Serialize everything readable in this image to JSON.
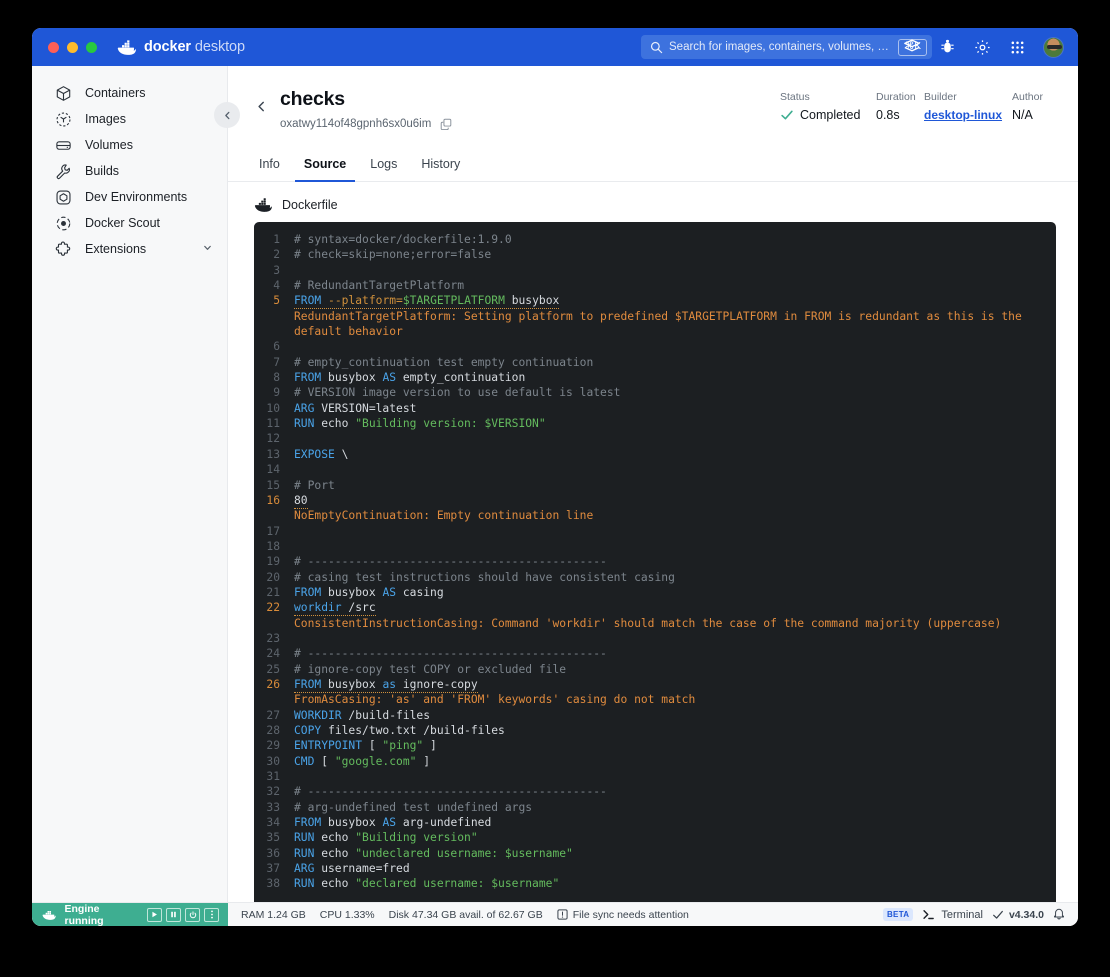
{
  "titlebar": {
    "brand_bold": "docker",
    "brand_light": "desktop",
    "search_placeholder": "Search for images, containers, volumes, extensi...",
    "shortcut": "⌘K",
    "icons": [
      "extensions-icon",
      "bug-icon",
      "gear-icon",
      "grid-icon",
      "avatar"
    ]
  },
  "sidebar": {
    "items": [
      {
        "label": "Containers",
        "icon": "container-icon"
      },
      {
        "label": "Images",
        "icon": "images-icon"
      },
      {
        "label": "Volumes",
        "icon": "volumes-icon"
      },
      {
        "label": "Builds",
        "icon": "wrench-icon"
      },
      {
        "label": "Dev Environments",
        "icon": "dev-environments-icon"
      },
      {
        "label": "Docker Scout",
        "icon": "docker-scout-icon"
      },
      {
        "label": "Extensions",
        "icon": "extensions-puzzle-icon"
      }
    ]
  },
  "header": {
    "title": "checks",
    "build_id": "oxatwy114of48gpnh6sx0u6im",
    "meta": {
      "status_label": "Status",
      "status_value": "Completed",
      "duration_label": "Duration",
      "duration_value": "0.8s",
      "builder_label": "Builder",
      "builder_value": "desktop-linux",
      "author_label": "Author",
      "author_value": "N/A"
    }
  },
  "tabs": [
    {
      "label": "Info",
      "active": false
    },
    {
      "label": "Source",
      "active": true
    },
    {
      "label": "Logs",
      "active": false
    },
    {
      "label": "History",
      "active": false
    }
  ],
  "file": {
    "name": "Dockerfile"
  },
  "code": {
    "lines": [
      {
        "n": "1",
        "tokens": [
          {
            "t": "# syntax=docker/dockerfile:1.9.0",
            "c": "cm"
          }
        ]
      },
      {
        "n": "2",
        "tokens": [
          {
            "t": "# check=skip=none;error=false",
            "c": "cm"
          }
        ]
      },
      {
        "n": "3",
        "tokens": []
      },
      {
        "n": "4",
        "tokens": [
          {
            "t": "# RedundantTargetPlatform",
            "c": "cm"
          }
        ]
      },
      {
        "n": "5",
        "warn": true,
        "underline": true,
        "tokens": [
          {
            "t": "FROM",
            "c": "kw"
          },
          {
            "t": " ",
            "c": ""
          },
          {
            "t": "--platform=",
            "c": "fl"
          },
          {
            "t": "$TARGETPLATFORM",
            "c": "var"
          },
          {
            "t": " busybox",
            "c": ""
          }
        ]
      },
      {
        "msg": "RedundantTargetPlatform: Setting platform to predefined $TARGETPLATFORM in FROM is redundant as this is the default behavior"
      },
      {
        "n": "6",
        "tokens": []
      },
      {
        "n": "7",
        "tokens": [
          {
            "t": "# empty_continuation test empty continuation",
            "c": "cm"
          }
        ]
      },
      {
        "n": "8",
        "tokens": [
          {
            "t": "FROM",
            "c": "kw"
          },
          {
            "t": " busybox ",
            "c": ""
          },
          {
            "t": "AS",
            "c": "kw"
          },
          {
            "t": " empty_continuation",
            "c": ""
          }
        ]
      },
      {
        "n": "9",
        "tokens": [
          {
            "t": "# VERSION image version to use default is latest",
            "c": "cm"
          }
        ]
      },
      {
        "n": "10",
        "tokens": [
          {
            "t": "ARG",
            "c": "kw"
          },
          {
            "t": " VERSION=latest",
            "c": ""
          }
        ]
      },
      {
        "n": "11",
        "tokens": [
          {
            "t": "RUN",
            "c": "kw"
          },
          {
            "t": " echo ",
            "c": ""
          },
          {
            "t": "\"Building version: $VERSION\"",
            "c": "st"
          }
        ]
      },
      {
        "n": "12",
        "tokens": []
      },
      {
        "n": "13",
        "tokens": [
          {
            "t": "EXPOSE",
            "c": "kw"
          },
          {
            "t": " \\",
            "c": ""
          }
        ]
      },
      {
        "n": "14",
        "tokens": []
      },
      {
        "n": "15",
        "tokens": [
          {
            "t": "# Port",
            "c": "cm"
          }
        ]
      },
      {
        "n": "16",
        "warn": true,
        "underline": true,
        "tokens": [
          {
            "t": "80",
            "c": ""
          }
        ]
      },
      {
        "msg": "NoEmptyContinuation: Empty continuation line"
      },
      {
        "n": "17",
        "tokens": []
      },
      {
        "n": "18",
        "tokens": []
      },
      {
        "n": "19",
        "tokens": [
          {
            "t": "# --------------------------------------------",
            "c": "cm"
          }
        ]
      },
      {
        "n": "20",
        "tokens": [
          {
            "t": "# casing test instructions should have consistent casing",
            "c": "cm"
          }
        ]
      },
      {
        "n": "21",
        "tokens": [
          {
            "t": "FROM",
            "c": "kw"
          },
          {
            "t": " busybox ",
            "c": ""
          },
          {
            "t": "AS",
            "c": "kw"
          },
          {
            "t": " casing",
            "c": ""
          }
        ]
      },
      {
        "n": "22",
        "warn": true,
        "underline": true,
        "tokens": [
          {
            "t": "workdir",
            "c": "kw"
          },
          {
            "t": " /src",
            "c": ""
          }
        ]
      },
      {
        "msg": "ConsistentInstructionCasing: Command 'workdir' should match the case of the command majority (uppercase)"
      },
      {
        "n": "23",
        "tokens": []
      },
      {
        "n": "24",
        "tokens": [
          {
            "t": "# --------------------------------------------",
            "c": "cm"
          }
        ]
      },
      {
        "n": "25",
        "tokens": [
          {
            "t": "# ignore-copy test COPY or excluded file",
            "c": "cm"
          }
        ]
      },
      {
        "n": "26",
        "warn": true,
        "underline": true,
        "tokens": [
          {
            "t": "FROM",
            "c": "kw"
          },
          {
            "t": " busybox ",
            "c": ""
          },
          {
            "t": "as",
            "c": "kw"
          },
          {
            "t": " ignore-copy",
            "c": ""
          }
        ]
      },
      {
        "msg": "FromAsCasing: 'as' and 'FROM' keywords' casing do not match"
      },
      {
        "n": "27",
        "tokens": [
          {
            "t": "WORKDIR",
            "c": "kw"
          },
          {
            "t": " /build-files",
            "c": ""
          }
        ]
      },
      {
        "n": "28",
        "tokens": [
          {
            "t": "COPY",
            "c": "kw"
          },
          {
            "t": " files/two.txt /build-files",
            "c": ""
          }
        ]
      },
      {
        "n": "29",
        "tokens": [
          {
            "t": "ENTRYPOINT",
            "c": "kw"
          },
          {
            "t": " [ ",
            "c": ""
          },
          {
            "t": "\"ping\"",
            "c": "st"
          },
          {
            "t": " ]",
            "c": ""
          }
        ]
      },
      {
        "n": "30",
        "tokens": [
          {
            "t": "CMD",
            "c": "kw"
          },
          {
            "t": " [ ",
            "c": ""
          },
          {
            "t": "\"google.com\"",
            "c": "st"
          },
          {
            "t": " ]",
            "c": ""
          }
        ]
      },
      {
        "n": "31",
        "tokens": []
      },
      {
        "n": "32",
        "tokens": [
          {
            "t": "# --------------------------------------------",
            "c": "cm"
          }
        ]
      },
      {
        "n": "33",
        "tokens": [
          {
            "t": "# arg-undefined test undefined args",
            "c": "cm"
          }
        ]
      },
      {
        "n": "34",
        "tokens": [
          {
            "t": "FROM",
            "c": "kw"
          },
          {
            "t": " busybox ",
            "c": ""
          },
          {
            "t": "AS",
            "c": "kw"
          },
          {
            "t": " arg-undefined",
            "c": ""
          }
        ]
      },
      {
        "n": "35",
        "tokens": [
          {
            "t": "RUN",
            "c": "kw"
          },
          {
            "t": " echo ",
            "c": ""
          },
          {
            "t": "\"Building version\"",
            "c": "st"
          }
        ]
      },
      {
        "n": "36",
        "tokens": [
          {
            "t": "RUN",
            "c": "kw"
          },
          {
            "t": " echo ",
            "c": ""
          },
          {
            "t": "\"undeclared username: $username\"",
            "c": "st"
          }
        ]
      },
      {
        "n": "37",
        "tokens": [
          {
            "t": "ARG",
            "c": "kw"
          },
          {
            "t": " username=fred",
            "c": ""
          }
        ]
      },
      {
        "n": "38",
        "tokens": [
          {
            "t": "RUN",
            "c": "kw"
          },
          {
            "t": " echo ",
            "c": ""
          },
          {
            "t": "\"declared username: $username\"",
            "c": "st"
          }
        ]
      }
    ]
  },
  "statusbar": {
    "engine": "Engine running",
    "ram": "RAM 1.24 GB",
    "cpu": "CPU 1.33%",
    "disk": "Disk 47.34 GB avail. of 62.67 GB",
    "sync": "File sync needs attention",
    "beta": "BETA",
    "terminal": "Terminal",
    "version": "v4.34.0"
  },
  "colors": {
    "brand_blue": "#1f57d7",
    "engine_green": "#3eae91",
    "code_bg": "#1c1f22",
    "keyword": "#4aa3e8",
    "string": "#64bb5e",
    "comment": "#7c848c",
    "warning": "#e08b3e"
  }
}
